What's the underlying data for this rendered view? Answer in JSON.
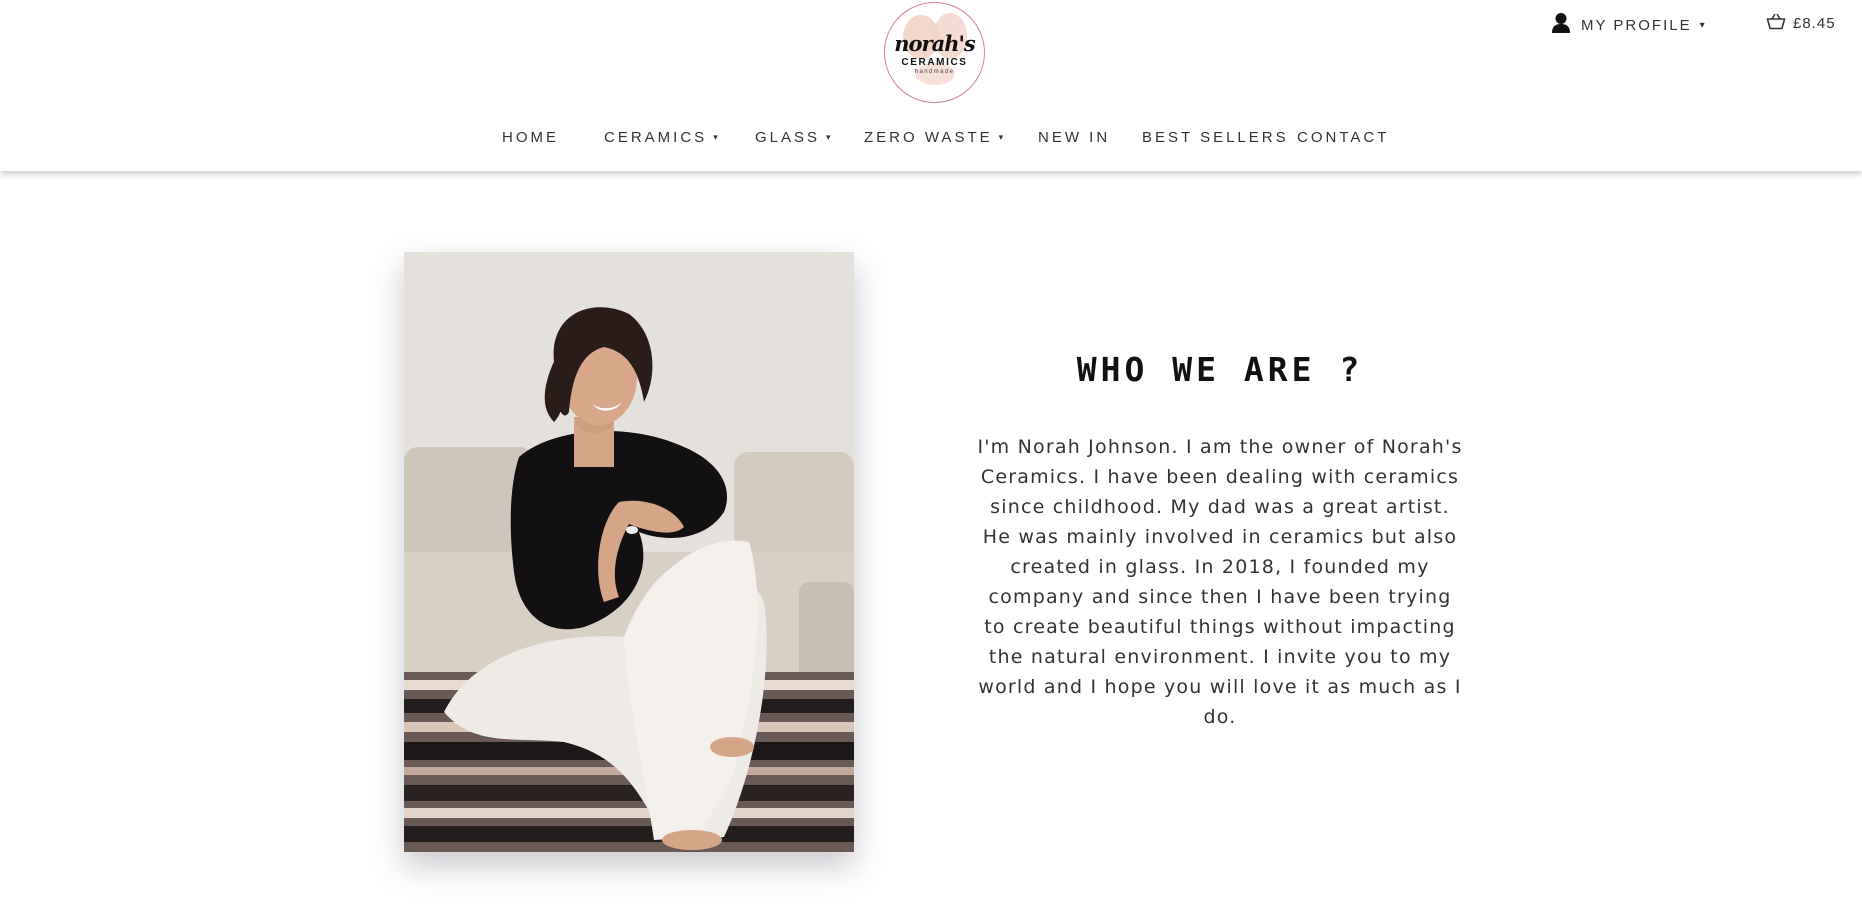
{
  "brand": {
    "logo_script": "norah's",
    "logo_word": "CERAMICS",
    "logo_small": "handmade",
    "accent_color": "#d97f99"
  },
  "header": {
    "profile": {
      "icon": "user-icon",
      "label": "MY PROFILE",
      "caret": "▾"
    },
    "cart": {
      "icon": "basket-icon",
      "amount": "£8.45"
    }
  },
  "nav": {
    "items": [
      {
        "label": "HOME"
      },
      {
        "label": "CERAMICS",
        "caret": "▾"
      },
      {
        "label": "GLASS",
        "caret": "▾"
      },
      {
        "label": "ZERO WASTE",
        "caret": "▾"
      },
      {
        "label": "NEW IN"
      },
      {
        "label": "BEST SELLERS"
      },
      {
        "label": "CONTACT"
      }
    ]
  },
  "about": {
    "title": "WHO WE ARE ?",
    "bio": "I'm Norah Johnson. I am the owner of Norah's Ceramics. I have been dealing with ceramics since childhood. My dad was a great artist. He was mainly involved in ceramics but also created in glass. In 2018, I founded my company and since then I have been trying to create beautiful things without impacting the natural environment. I invite you to my world and I hope you will love it as much as I do."
  }
}
